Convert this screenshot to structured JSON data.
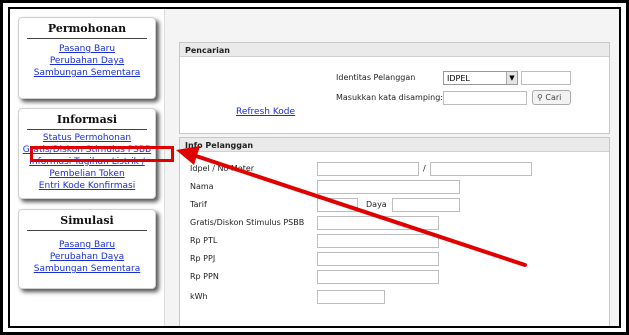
{
  "permohonan": {
    "title": "Permohonan",
    "links": [
      "Pasang Baru",
      "Perubahan Daya",
      "Sambungan Sementara"
    ]
  },
  "informasi": {
    "title": "Informasi",
    "links": [
      "Status Permohonan",
      "Gratis/Diskon Stimulus PSBB",
      "Informasi Tagihan Listrik /",
      "Pembelian Token",
      "Entri Kode Konfirmasi"
    ]
  },
  "simulasi": {
    "title": "Simulasi",
    "links": [
      "Pasang Baru",
      "Perubahan Daya",
      "Sambungan Sementara"
    ]
  },
  "pencarian": {
    "title": "Pencarian",
    "identitas_label": "Identitas Pelanggan",
    "identitas_value": "IDPEL",
    "kata_label": "Masukkan kata disamping:",
    "cari_label": "Cari",
    "refresh_label": "Refresh Kode"
  },
  "info": {
    "title": "Info Pelanggan",
    "idpel_label": "Idpel / No Meter",
    "idpel_sep": "/",
    "nama_label": "Nama",
    "tarif_label": "Tarif",
    "daya_label": "Daya",
    "gratis_label": "Gratis/Diskon Stimulus PSBB",
    "ptl_label": "Rp PTL",
    "ppj_label": "Rp PPJ",
    "ppn_label": "Rp PPN",
    "kwh_label": "kWh"
  },
  "annotation": {
    "color": "#e00000"
  }
}
